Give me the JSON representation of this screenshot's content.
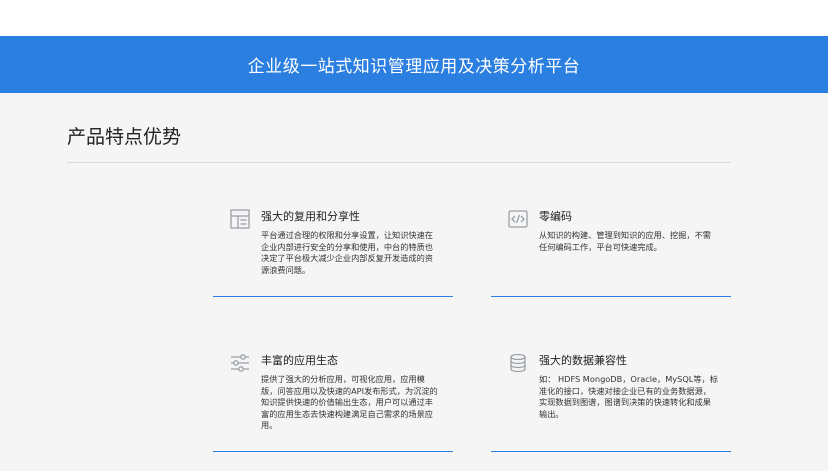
{
  "banner": {
    "title": "企业级一站式知识管理应用及决策分析平台"
  },
  "section": {
    "title": "产品特点优势"
  },
  "features": [
    {
      "icon": "layout-icon",
      "title": "强大的复用和分享性",
      "desc": "平台通过合理的权限和分享设置，让知识快速在企业内部进行安全的分享和使用，中台的特质也决定了平台极大减少企业内部反复开发造成的资源浪费问题。"
    },
    {
      "icon": "code-icon",
      "title": "零编码",
      "desc": "从知识的构建、管理到知识的应用、挖掘，不需任何编码工作，平台可快速完成。"
    },
    {
      "icon": "sliders-icon",
      "title": "丰富的应用生态",
      "desc": "提供了强大的分析应用，可视化应用，应用模版，问答应用以及快速的API发布形式，为沉淀的知识提供快速的价值输出生态，用户可以通过丰富的应用生态去快速构建满足自己需求的场景应用。"
    },
    {
      "icon": "database-icon",
      "title": "强大的数据兼容性",
      "desc": "如： HDFS MongoDB，Oracle，MySQL等，标准化的接口，快速对接企业已有的业务数据源，实现数据到图谱，图谱到决策的快速转化和成果输出。"
    }
  ]
}
